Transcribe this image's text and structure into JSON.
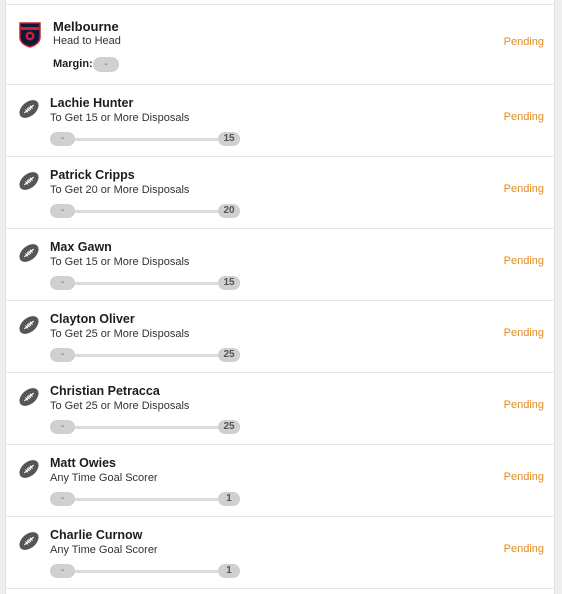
{
  "team_bet": {
    "team": "Melbourne",
    "market": "Head to Head",
    "margin_label": "Margin:",
    "margin_value": "-",
    "status": "Pending"
  },
  "bets": [
    {
      "player": "Lachie Hunter",
      "market": "To Get 15 or More Disposals",
      "current": "-",
      "target": "15",
      "status": "Pending"
    },
    {
      "player": "Patrick Cripps",
      "market": "To Get 20 or More Disposals",
      "current": "-",
      "target": "20",
      "status": "Pending"
    },
    {
      "player": "Max Gawn",
      "market": "To Get 15 or More Disposals",
      "current": "-",
      "target": "15",
      "status": "Pending"
    },
    {
      "player": "Clayton Oliver",
      "market": "To Get 25 or More Disposals",
      "current": "-",
      "target": "25",
      "status": "Pending"
    },
    {
      "player": "Christian Petracca",
      "market": "To Get 25 or More Disposals",
      "current": "-",
      "target": "25",
      "status": "Pending"
    },
    {
      "player": "Matt Owies",
      "market": "Any Time Goal Scorer",
      "current": "-",
      "target": "1",
      "status": "Pending"
    },
    {
      "player": "Charlie Curnow",
      "market": "Any Time Goal Scorer",
      "current": "-",
      "target": "1",
      "status": "Pending"
    }
  ],
  "colors": {
    "pending": "#e58a1b",
    "logo_red": "#d0202e",
    "logo_navy": "#0b1a3a"
  },
  "icons": {
    "team": "melbourne-logo-icon",
    "player": "football-icon"
  }
}
